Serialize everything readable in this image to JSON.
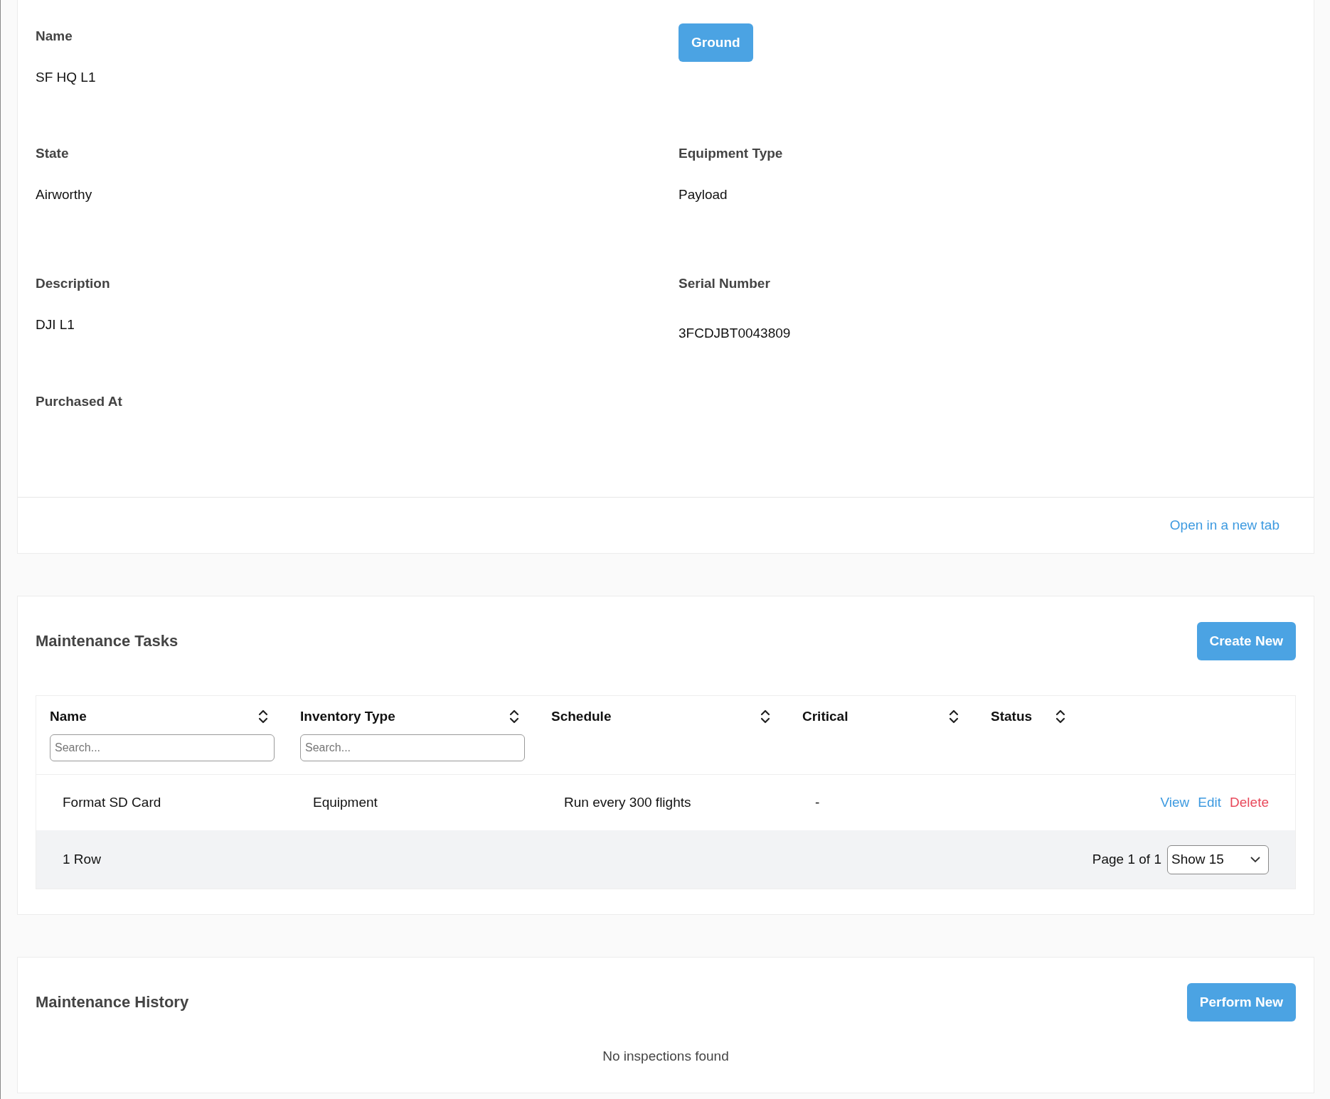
{
  "details": {
    "fields": [
      {
        "label": "Name",
        "value": "SF HQ L1"
      },
      {
        "kind": "button",
        "label": "Ground"
      },
      {
        "label": "State",
        "value": "Airworthy"
      },
      {
        "label": "Equipment Type",
        "value": "Payload"
      },
      {
        "label": "Description",
        "value": "DJI L1"
      },
      {
        "label": "Serial Number",
        "value": "3FCDJBT0043809"
      },
      {
        "label": "Purchased At"
      }
    ],
    "footer_link": "Open in a new tab"
  },
  "maintenance_tasks": {
    "title": "Maintenance Tasks",
    "button": "Create New",
    "table": {
      "columns": [
        {
          "label": "Name",
          "placeholder": "Search..."
        },
        {
          "label": "Inventory Type",
          "placeholder": "Search..."
        },
        {
          "label": "Schedule"
        },
        {
          "label": "Critical"
        },
        {
          "label": "Status"
        }
      ],
      "rows": [
        {
          "cells": [
            "Format SD Card",
            "Equipment",
            "Run every 300 flights",
            "-",
            ""
          ],
          "actions": [
            {
              "label": "View",
              "kind": "link"
            },
            {
              "label": "Edit",
              "kind": "link"
            },
            {
              "label": "Delete",
              "kind": "danger"
            }
          ]
        }
      ],
      "footer": {
        "count": "1 Row",
        "page": "Page 1 of 1",
        "page_size": "Show 15"
      }
    }
  },
  "maintenance_history": {
    "title": "Maintenance History",
    "button": "Perform New",
    "empty": "No inspections found"
  }
}
